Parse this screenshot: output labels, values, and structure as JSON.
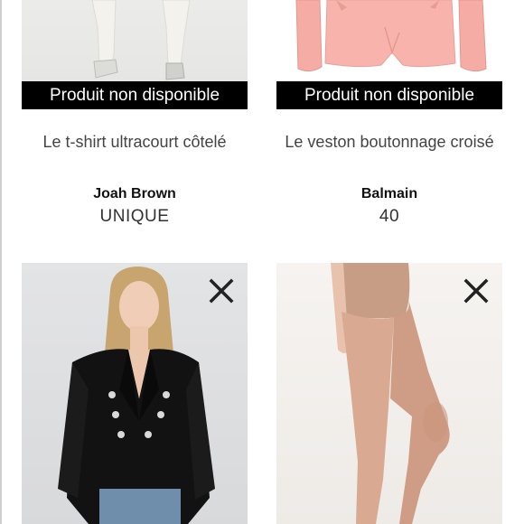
{
  "products": [
    {
      "name": "Le t-shirt ultracourt côtelé",
      "brand": "Joah Brown",
      "size": "UNIQUE",
      "status": "Produit non disponible",
      "image_icon": "white-pants-model-image"
    },
    {
      "name": "Le veston boutonnage croisé",
      "brand": "Balmain",
      "size": "40",
      "status": "Produit non disponible",
      "image_icon": "pink-blazer-image"
    },
    {
      "image_icon": "black-blazer-model-image",
      "remove_icon": "close-icon"
    },
    {
      "image_icon": "tights-legs-image",
      "remove_icon": "close-icon"
    }
  ]
}
